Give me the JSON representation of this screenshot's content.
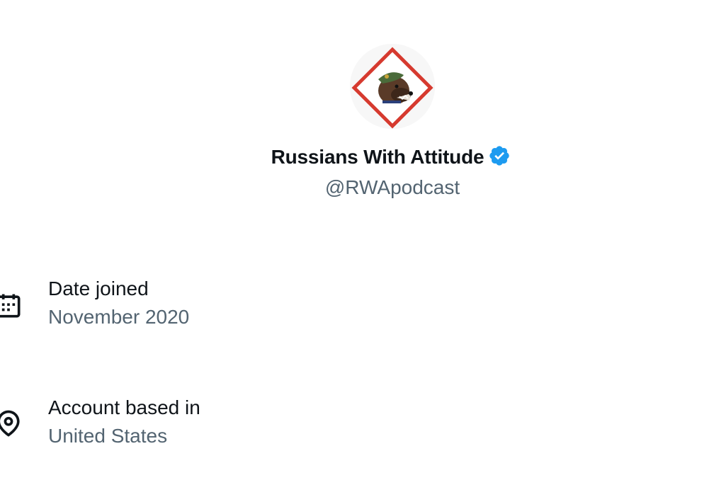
{
  "profile": {
    "display_name": "Russians With Attitude",
    "handle": "@RWApodcast",
    "verified": true,
    "avatar_icon": "bear-soldier-diamond-logo"
  },
  "about": [
    {
      "icon": "calendar-icon",
      "label": "Date joined",
      "value": "November 2020"
    },
    {
      "icon": "location-pin-icon",
      "label": "Account based in",
      "value": "United States"
    }
  ],
  "colors": {
    "text_primary": "#0f1419",
    "text_secondary": "#536471",
    "verified_blue": "#1d9bf0",
    "logo_red": "#d63a2f"
  }
}
